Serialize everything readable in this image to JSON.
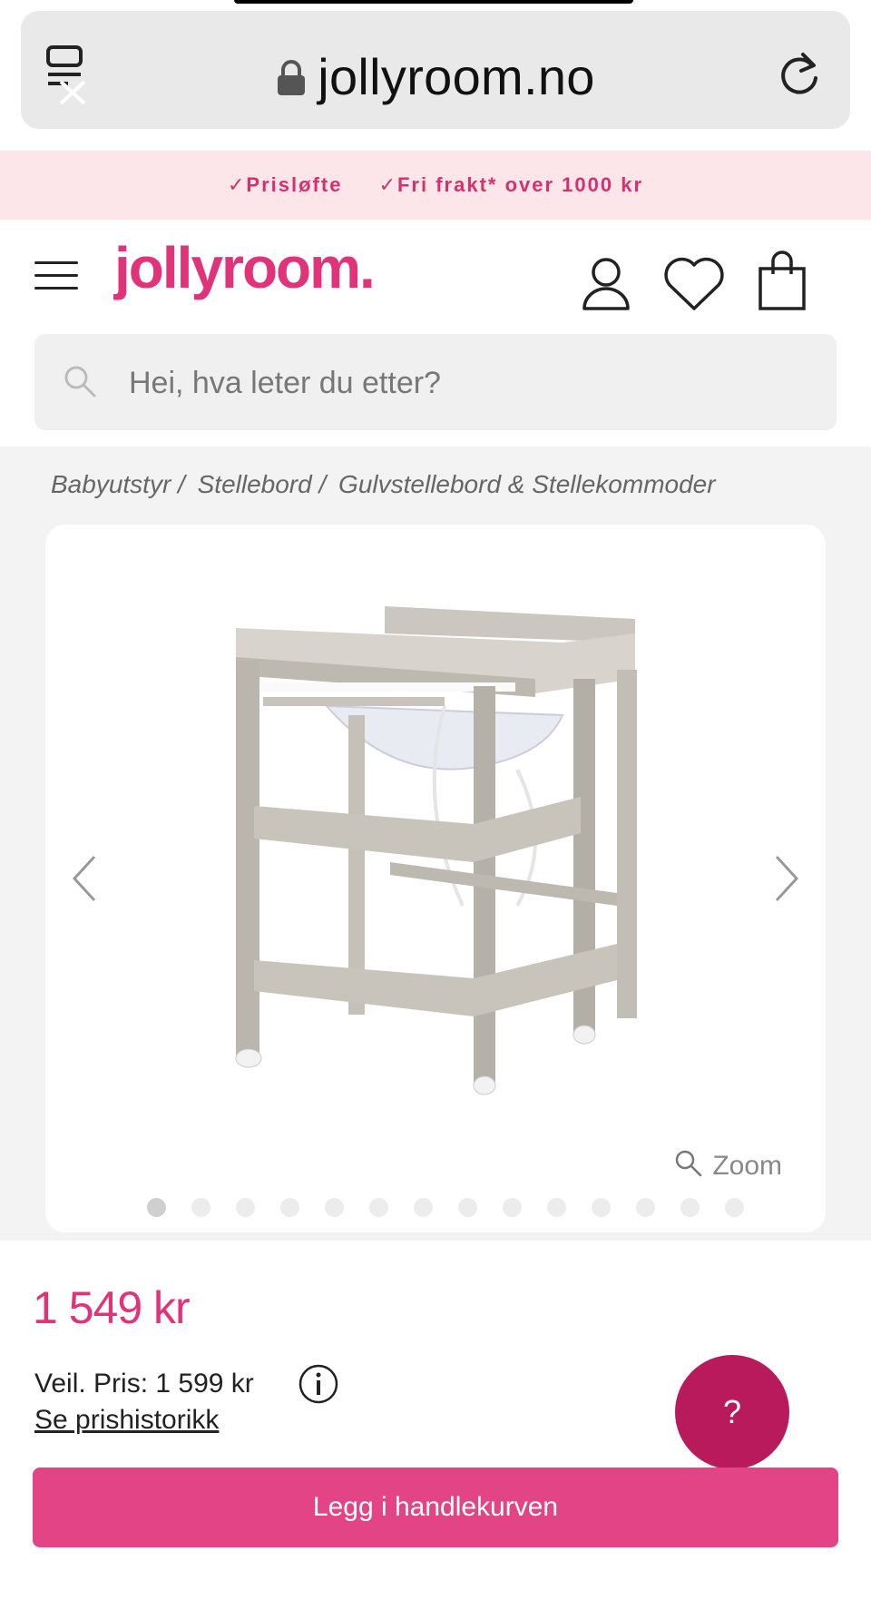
{
  "browser": {
    "url": "jollyroom.no",
    "icons": [
      "tabs-close-icon",
      "lock-icon",
      "reload-icon"
    ]
  },
  "promo": {
    "items": [
      "✓Prisløfte",
      "✓Fri frakt* over 1000 kr"
    ],
    "color": "#d7306e",
    "background": "#fde6ea"
  },
  "header": {
    "logo": "jollyroom.",
    "brand_color": "#e0337a",
    "icons": [
      "menu-icon",
      "user-icon",
      "heart-icon",
      "bag-icon"
    ]
  },
  "search": {
    "placeholder": "Hei, hva leter du etter?"
  },
  "breadcrumb": [
    "Babyutstyr /",
    "Stellebord /",
    "Gulvstellebord & Stellekommoder"
  ],
  "gallery": {
    "zoom_label": "Zoom",
    "image_count": 14,
    "active_index": 0
  },
  "product": {
    "price": "1 549 kr",
    "recommended_price": "Veil. Pris: 1 599 kr",
    "price_history_link": "Se prishistorikk",
    "add_to_cart": "Legg i handlekurven",
    "help_label": "?",
    "cart_button_color": "#e34485",
    "help_button_color": "#b81a5c"
  }
}
